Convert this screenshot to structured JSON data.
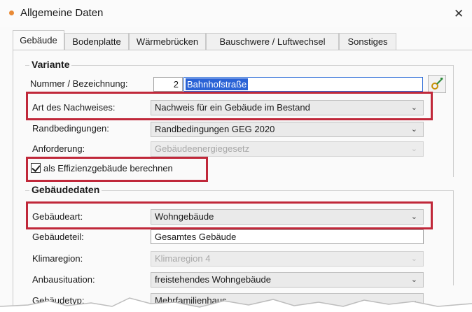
{
  "window": {
    "title": "Allgemeine Daten"
  },
  "tabs": [
    {
      "label": "Gebäude"
    },
    {
      "label": "Bodenplatte"
    },
    {
      "label": "Wärmebrücken"
    },
    {
      "label": "Bauschwere / Luftwechsel"
    },
    {
      "label": "Sonstiges"
    }
  ],
  "variante": {
    "title": "Variante",
    "nummer_label": "Nummer / Bezeichnung:",
    "nummer_value": "2",
    "bezeichnung_value": "Bahnhofstraße",
    "art_label": "Art des Nachweises:",
    "art_value": "Nachweis für ein Gebäude im Bestand",
    "rand_label": "Randbedingungen:",
    "rand_value": "Randbedingungen GEG 2020",
    "anf_label": "Anforderung:",
    "anf_value": "Gebäudeenergiegesetz",
    "effizienz_label": "als Effizienzgebäude berechnen",
    "effizienz_checked": true
  },
  "gebaeudedaten": {
    "title": "Gebäudedaten",
    "art_label": "Gebäudeart:",
    "art_value": "Wohngebäude",
    "teil_label": "Gebäudeteil:",
    "teil_value": "Gesamtes Gebäude",
    "klima_label": "Klimaregion:",
    "klima_value": "Klimaregion 4",
    "anbau_label": "Anbausituation:",
    "anbau_value": "freistehendes Wohngebäude",
    "typ_label": "Gebäudetyp:",
    "typ_value": "Mehrfamilienhaus"
  },
  "colors": {
    "highlight": "#c0283a",
    "selection": "#2a63d6",
    "title_dot": "#e98a36"
  },
  "icons": {
    "close": "close-icon",
    "title": "dot-icon",
    "edit": "edit-icon"
  }
}
